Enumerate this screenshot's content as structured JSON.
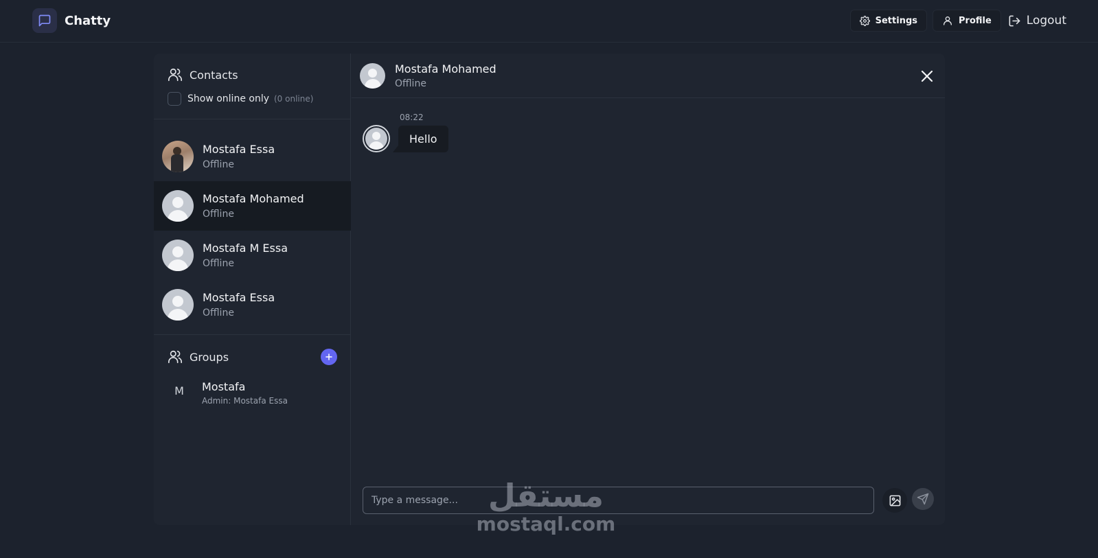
{
  "app": {
    "name": "Chatty",
    "icon": "message-square-icon",
    "accent": "#6366f1"
  },
  "nav": {
    "settings_label": "Settings",
    "profile_label": "Profile",
    "logout_label": "Logout"
  },
  "sidebar": {
    "contacts_title": "Contacts",
    "online_filter_label": "Show online only",
    "online_count": "(0 online)",
    "contacts": [
      {
        "name": "Mostafa Essa",
        "status": "Offline",
        "avatar": "photo",
        "selected": false
      },
      {
        "name": "Mostafa Mohamed",
        "status": "Offline",
        "avatar": "default",
        "selected": true
      },
      {
        "name": "Mostafa M Essa",
        "status": "Offline",
        "avatar": "default",
        "selected": false
      },
      {
        "name": "Mostafa Essa",
        "status": "Offline",
        "avatar": "default",
        "selected": false
      }
    ],
    "groups_title": "Groups",
    "groups": [
      {
        "initial": "M",
        "name": "Mostafa",
        "admin": "Admin: Mostafa Essa"
      }
    ]
  },
  "chat": {
    "header": {
      "name": "Mostafa Mohamed",
      "status": "Offline"
    },
    "messages": [
      {
        "time": "08:22",
        "text": "Hello"
      }
    ],
    "input_placeholder": "Type a message..."
  },
  "watermark": {
    "arabic": "مستقل",
    "latin": "mostaql.com"
  }
}
